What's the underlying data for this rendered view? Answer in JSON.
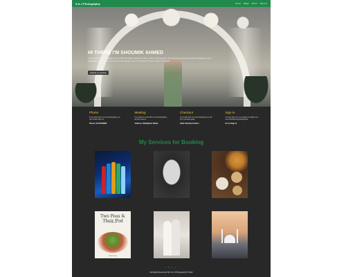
{
  "navbar": {
    "brand": "S.A.J Photography",
    "links": [
      "Home",
      "Blogs",
      "About",
      "Sign Up"
    ],
    "bg_color": "#1f8a4c"
  },
  "hero": {
    "title": "HI THERE I'M SHOUMIK AHMED",
    "description": "I am a professional photographer since 2015. My studio is pleased to take a variety of photography. I also help you by shooting wedding photography, event photography and product & aesthetic and photography. I am the studio and. Please explore the website.",
    "button_label": "Explore my services"
  },
  "info": [
    {
      "title": "Phone",
      "text": "If you wish to hire me for photography you can contact with me.",
      "strong": "Phone: 01712345865"
    },
    {
      "title": "Meeting",
      "text": "If you want to meet with me for photography, we can meet at",
      "strong": "Address: Mohakhali, Dhaka"
    },
    {
      "title": "Checkout",
      "text": "If you want hire me for photography you can go to checkout page",
      "strong": "Click Checkout button"
    },
    {
      "title": "Sign In",
      "text": "You can sign in on my website to register me as a professional photographer.",
      "strong": "Go To Sign In"
    }
  ],
  "services": {
    "title": "My Services for Booking",
    "title_color": "#1f8a4c",
    "cards": [
      {
        "name": "soft-drink-product-photo"
      },
      {
        "name": "portrait-photo"
      },
      {
        "name": "food-event-photo"
      },
      {
        "name": "cookbook-cover-photo",
        "book_title": "Two Peas & Their Pod",
        "book_subtitle": "COOKBOOK",
        "book_author": "Maria Lichty"
      },
      {
        "name": "wedding-couple-photo"
      },
      {
        "name": "mosque-travel-photo"
      }
    ]
  },
  "footer": {
    "social_icons": "f  ♥  ◎  ▸",
    "copyright": "All Rights Reserved By S.A.J Photography© 2022"
  },
  "colors": {
    "accent": "#1f8a4c",
    "info_title": "#f2c230",
    "page_bg": "#282828"
  }
}
